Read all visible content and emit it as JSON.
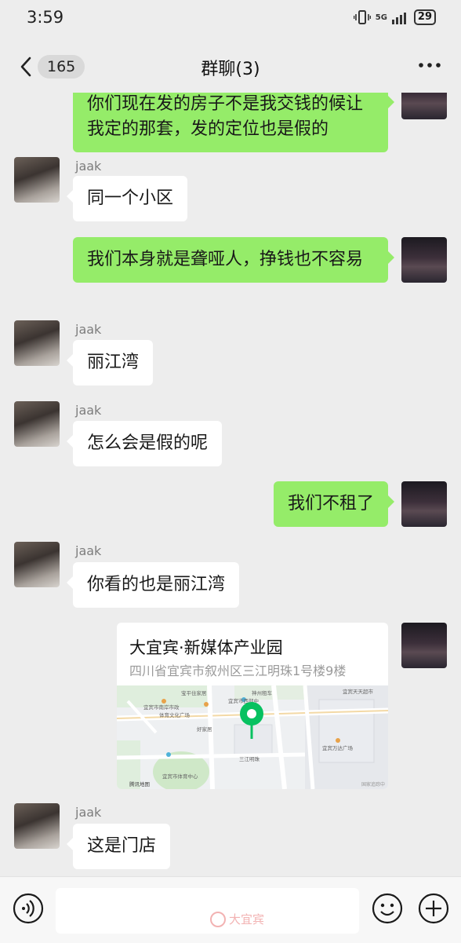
{
  "status_bar": {
    "time": "3:59",
    "network": "5G",
    "battery": "29"
  },
  "header": {
    "unread_count": "165",
    "title": "群聊(3)"
  },
  "messages": [
    {
      "side": "out",
      "text": "你们现在发的房子不是我交钱的候让我定的那套，发的定位也是假的"
    },
    {
      "side": "in",
      "sender": "jaak",
      "text": "同一个小区"
    },
    {
      "side": "out",
      "text": "我们本身就是聋哑人，挣钱也不容易"
    },
    {
      "side": "in",
      "sender": "jaak",
      "text": "丽江湾"
    },
    {
      "side": "in",
      "sender": "jaak",
      "text": "怎么会是假的呢"
    },
    {
      "side": "out",
      "text": "我们不租了"
    },
    {
      "side": "in",
      "sender": "jaak",
      "text": "你看的也是丽江湾"
    },
    {
      "side": "out",
      "type": "location",
      "name": "大宜宾·新媒体产业园",
      "address": "四川省宜宾市叙州区三江明珠1号楼9楼",
      "map_labels": [
        "宝平住家居",
        "神州租车",
        "宜宾天天超市",
        "宜宾市南岸市政",
        "体育文化广场",
        "宜宾市西部中",
        "好家居",
        "三江明珠",
        "宜宾万达广场",
        "宜宾市体育中心",
        "腾讯地图",
        "国家追踪中"
      ],
      "accent_color": "#07c160"
    },
    {
      "side": "in",
      "sender": "jaak",
      "text": "这是门店"
    }
  ],
  "input_bar": {
    "icons": [
      "voice-icon",
      "emoji-icon",
      "plus-icon"
    ]
  },
  "watermark": "大宜宾"
}
